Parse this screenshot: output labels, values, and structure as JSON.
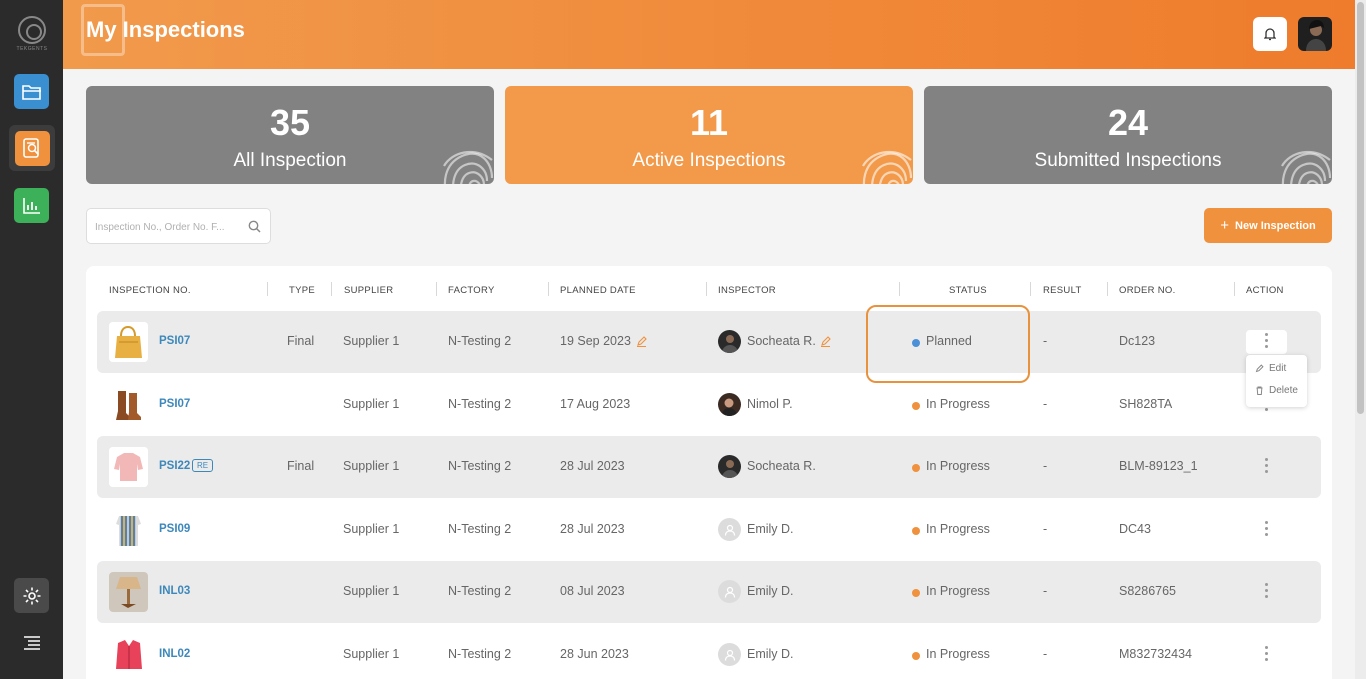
{
  "app": {
    "logo_text": "TEKGENTS"
  },
  "header": {
    "title": "My Inspections"
  },
  "stats": [
    {
      "count": "35",
      "label": "All Inspection"
    },
    {
      "count": "11",
      "label": "Active Inspections"
    },
    {
      "count": "24",
      "label": "Submitted Inspections"
    }
  ],
  "search": {
    "placeholder": "Inspection No., Order No. F..."
  },
  "new_button": {
    "label": "New Inspection"
  },
  "columns": [
    "INSPECTION NO.",
    "TYPE",
    "SUPPLIER",
    "FACTORY",
    "PLANNED DATE",
    "INSPECTOR",
    "STATUS",
    "RESULT",
    "ORDER NO.",
    "ACTION"
  ],
  "rows": [
    {
      "no": "PSI07",
      "badge": "",
      "type": "Final",
      "supplier": "Supplier 1",
      "factory": "N-Testing 2",
      "date": "19 Sep 2023",
      "inspector": "Socheata R.",
      "status": "Planned",
      "result": "-",
      "order": "Dc123"
    },
    {
      "no": "PSI07",
      "badge": "",
      "type": "",
      "supplier": "Supplier 1",
      "factory": "N-Testing 2",
      "date": "17 Aug 2023",
      "inspector": "Nimol P.",
      "status": "In Progress",
      "result": "-",
      "order": "SH828TA"
    },
    {
      "no": "PSI22",
      "badge": "RE",
      "type": "Final",
      "supplier": "Supplier 1",
      "factory": "N-Testing 2",
      "date": "28 Jul 2023",
      "inspector": "Socheata R.",
      "status": "In Progress",
      "result": "-",
      "order": "BLM-89123_1"
    },
    {
      "no": "PSI09",
      "badge": "",
      "type": "",
      "supplier": "Supplier 1",
      "factory": "N-Testing 2",
      "date": "28 Jul 2023",
      "inspector": "Emily D.",
      "status": "In Progress",
      "result": "-",
      "order": "DC43"
    },
    {
      "no": "INL03",
      "badge": "",
      "type": "",
      "supplier": "Supplier 1",
      "factory": "N-Testing 2",
      "date": "08 Jul 2023",
      "inspector": "Emily D.",
      "status": "In Progress",
      "result": "-",
      "order": "S8286765"
    },
    {
      "no": "INL02",
      "badge": "",
      "type": "",
      "supplier": "Supplier 1",
      "factory": "N-Testing 2",
      "date": "28 Jun 2023",
      "inspector": "Emily D.",
      "status": "In Progress",
      "result": "-",
      "order": "M832732434"
    }
  ],
  "action_menu": {
    "edit": "Edit",
    "delete": "Delete"
  },
  "colors": {
    "accent": "#f0913d",
    "planned": "#4a90d9",
    "in_progress": "#f0913d",
    "link": "#3d88bb"
  }
}
